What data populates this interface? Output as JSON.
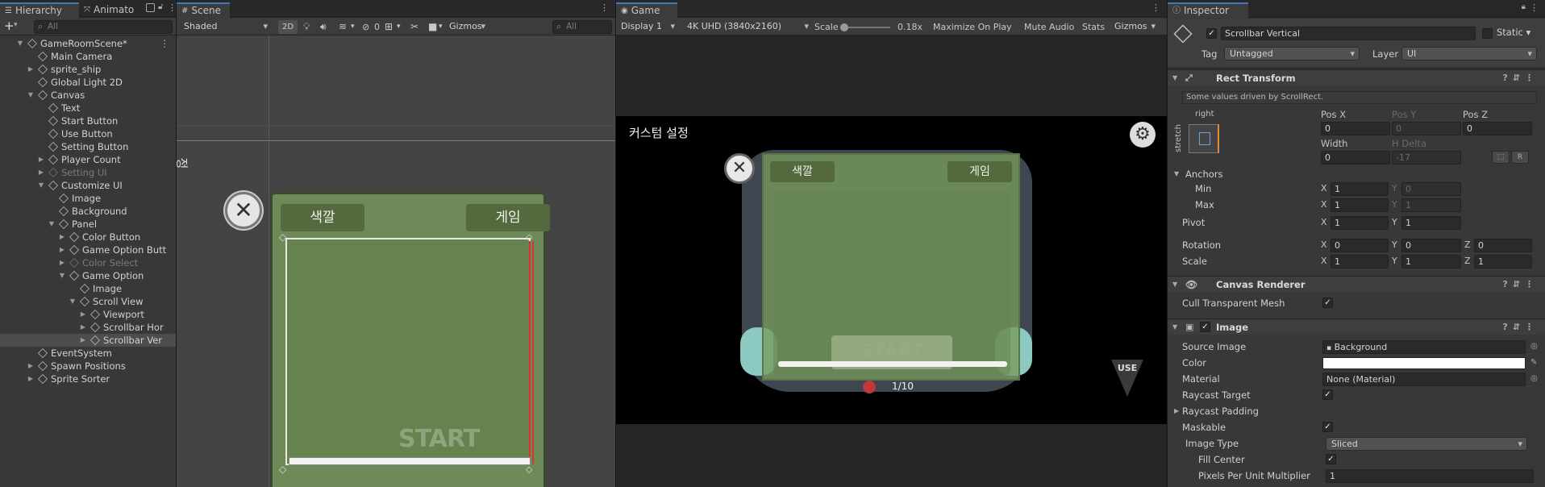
{
  "hierarchy": {
    "tab_hierarchy": "Hierarchy",
    "tab_animator": "Animato",
    "search_placeholder": "All",
    "add_label": "+",
    "items": [
      {
        "label": "GameRoomScene*",
        "depth": 0,
        "fold": "open",
        "kind": "scene",
        "selected": false,
        "dim": false
      },
      {
        "label": "Main Camera",
        "depth": 1,
        "fold": "none",
        "kind": "go",
        "selected": false,
        "dim": false
      },
      {
        "label": "sprite_ship",
        "depth": 1,
        "fold": "closed",
        "kind": "go",
        "selected": false,
        "dim": false
      },
      {
        "label": "Global Light 2D",
        "depth": 1,
        "fold": "none",
        "kind": "go",
        "selected": false,
        "dim": false
      },
      {
        "label": "Canvas",
        "depth": 1,
        "fold": "open",
        "kind": "go",
        "selected": false,
        "dim": false
      },
      {
        "label": "Text",
        "depth": 2,
        "fold": "none",
        "kind": "go",
        "selected": false,
        "dim": false
      },
      {
        "label": "Start Button",
        "depth": 2,
        "fold": "none",
        "kind": "go",
        "selected": false,
        "dim": false
      },
      {
        "label": "Use Button",
        "depth": 2,
        "fold": "none",
        "kind": "go",
        "selected": false,
        "dim": false
      },
      {
        "label": "Setting Button",
        "depth": 2,
        "fold": "none",
        "kind": "go",
        "selected": false,
        "dim": false
      },
      {
        "label": "Player Count",
        "depth": 2,
        "fold": "closed",
        "kind": "go",
        "selected": false,
        "dim": false
      },
      {
        "label": "Setting UI",
        "depth": 2,
        "fold": "closed",
        "kind": "go",
        "selected": false,
        "dim": true
      },
      {
        "label": "Customize UI",
        "depth": 2,
        "fold": "open",
        "kind": "go",
        "selected": false,
        "dim": false
      },
      {
        "label": "Image",
        "depth": 3,
        "fold": "none",
        "kind": "go",
        "selected": false,
        "dim": false
      },
      {
        "label": "Background",
        "depth": 3,
        "fold": "none",
        "kind": "go",
        "selected": false,
        "dim": false
      },
      {
        "label": "Panel",
        "depth": 3,
        "fold": "open",
        "kind": "go",
        "selected": false,
        "dim": false
      },
      {
        "label": "Color Button",
        "depth": 4,
        "fold": "closed",
        "kind": "go",
        "selected": false,
        "dim": false
      },
      {
        "label": "Game Option Butt",
        "depth": 4,
        "fold": "closed",
        "kind": "go",
        "selected": false,
        "dim": false
      },
      {
        "label": "Color Select",
        "depth": 4,
        "fold": "closed",
        "kind": "go",
        "selected": false,
        "dim": true
      },
      {
        "label": "Game Option",
        "depth": 4,
        "fold": "open",
        "kind": "go",
        "selected": false,
        "dim": false
      },
      {
        "label": "Image",
        "depth": 5,
        "fold": "none",
        "kind": "go",
        "selected": false,
        "dim": false
      },
      {
        "label": "Scroll View",
        "depth": 5,
        "fold": "open",
        "kind": "go",
        "selected": false,
        "dim": false
      },
      {
        "label": "Viewport",
        "depth": 6,
        "fold": "closed",
        "kind": "go",
        "selected": false,
        "dim": false
      },
      {
        "label": "Scrollbar Hor",
        "depth": 6,
        "fold": "closed",
        "kind": "go",
        "selected": false,
        "dim": false
      },
      {
        "label": "Scrollbar Ver",
        "depth": 6,
        "fold": "closed",
        "kind": "go",
        "selected": true,
        "dim": false
      },
      {
        "label": "EventSystem",
        "depth": 1,
        "fold": "none",
        "kind": "go",
        "selected": false,
        "dim": false
      },
      {
        "label": "Spawn Positions",
        "depth": 1,
        "fold": "closed",
        "kind": "go",
        "selected": false,
        "dim": false
      },
      {
        "label": "Sprite Sorter",
        "depth": 1,
        "fold": "closed",
        "kind": "go",
        "selected": false,
        "dim": false
      }
    ]
  },
  "scene": {
    "tab": "Scene",
    "shading": "Shaded",
    "mode_2d": "2D",
    "hidden_count": "0",
    "gizmos": "Gizmos",
    "search_placeholder": "All",
    "side_text": "정",
    "btn_color": "색깔",
    "btn_game": "게임",
    "start_text": "START"
  },
  "game": {
    "tab": "Game",
    "display": "Display 1",
    "resolution": "4K UHD (3840x2160)",
    "scale_label": "Scale",
    "scale_value": "0.18x",
    "maximize": "Maximize On Play",
    "mute": "Mute Audio",
    "stats": "Stats",
    "gizmos": "Gizmos",
    "title": "커스텀 설정",
    "btn_color": "색깔",
    "btn_game": "게임",
    "start_text": "START",
    "player_count": "1/10",
    "use_text": "USE"
  },
  "inspector": {
    "tab": "Inspector",
    "object_name": "Scrollbar Vertical",
    "static_label": "Static",
    "tag_label": "Tag",
    "tag_value": "Untagged",
    "layer_label": "Layer",
    "layer_value": "UI",
    "rect_transform": {
      "title": "Rect Transform",
      "driven_note": "Some values driven by ScrollRect.",
      "anchor_h": "right",
      "anchor_v": "stretch",
      "pos_x_label": "Pos X",
      "pos_x": "0",
      "pos_y_label": "Pos Y",
      "pos_y": "0",
      "pos_z_label": "Pos Z",
      "pos_z": "0",
      "width_label": "Width",
      "width": "0",
      "hdelta_label": "H Delta",
      "hdelta": "-17",
      "raw_btn": "R",
      "anchors_label": "Anchors",
      "min_label": "Min",
      "min_x": "1",
      "min_y": "0",
      "max_label": "Max",
      "max_x": "1",
      "max_y": "1",
      "pivot_label": "Pivot",
      "pivot_x": "1",
      "pivot_y": "1",
      "rotation_label": "Rotation",
      "rot_x": "0",
      "rot_y": "0",
      "rot_z": "0",
      "scale_label": "Scale",
      "scale_x": "1",
      "scale_y": "1",
      "scale_z": "1",
      "x": "X",
      "y": "Y",
      "z": "Z"
    },
    "canvas_renderer": {
      "title": "Canvas Renderer",
      "cull_label": "Cull Transparent Mesh"
    },
    "image": {
      "title": "Image",
      "source_label": "Source Image",
      "source_value": "Background",
      "color_label": "Color",
      "material_label": "Material",
      "material_value": "None (Material)",
      "raycast_label": "Raycast Target",
      "padding_label": "Raycast Padding",
      "maskable_label": "Maskable",
      "type_label": "Image Type",
      "type_value": "Sliced",
      "fill_label": "Fill Center",
      "ppu_label": "Pixels Per Unit Multiplier",
      "ppu_value": "1"
    }
  },
  "colors": {
    "panel_green": "#6e8a58",
    "panel_dark_green": "#5a7348",
    "accent_blue": "#3a79bb",
    "selection": "#4d4d4d"
  }
}
